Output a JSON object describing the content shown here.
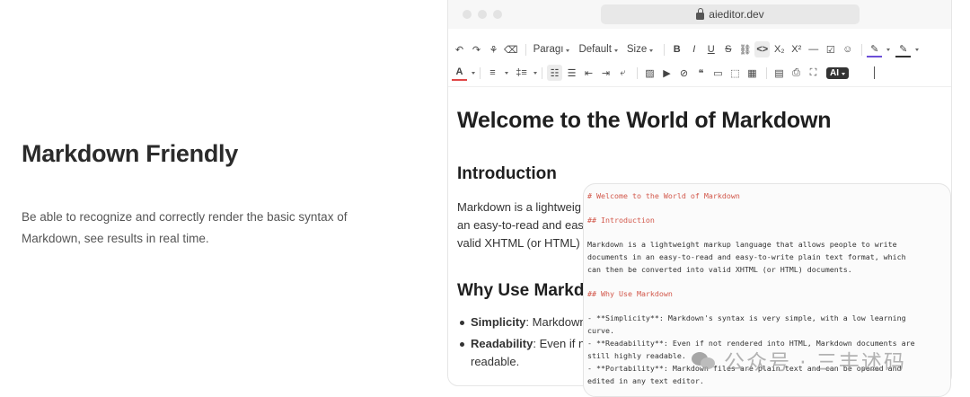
{
  "feature": {
    "title": "Markdown Friendly",
    "description": "Be able to recognize and correctly render the basic syntax of Markdown, see results in real time."
  },
  "browser": {
    "url": "aieditor.dev"
  },
  "toolbar": {
    "undo": "↶",
    "redo": "↷",
    "format_painter": "⚘",
    "eraser": "⌫",
    "paragraph": "Paragı",
    "font_family": "Default",
    "font_size": "Size",
    "bold": "B",
    "italic": "I",
    "underline": "U",
    "strike": "S",
    "link": "⛓",
    "code": "<>",
    "subscript": "X₂",
    "superscript": "X²",
    "hr": "—",
    "task": "☑",
    "emoji": "☺",
    "highlight": "✎",
    "font_color": "A",
    "align": "≡",
    "line_height": "‡≡",
    "bullet_list": "☷",
    "ordered_list": "☰",
    "indent_decrease": "⇤",
    "indent_increase": "⇥",
    "break": "⤶",
    "image": "▨",
    "video": "▶",
    "attachment": "⊘",
    "quote": "❝",
    "code_block": "▭",
    "container": "⬚",
    "table": "▦",
    "template": "▤",
    "print": "⎙",
    "fullscreen": "⛶",
    "ai": "AI"
  },
  "document": {
    "h1": "Welcome to the World of Markdown",
    "intro_heading": "Introduction",
    "intro_lines": [
      "Markdown is a lightweig",
      "an easy-to-read and easy",
      "valid XHTML (or HTML) c"
    ],
    "why_heading": "Why Use Markd",
    "list": [
      {
        "label": "Simplicity",
        "rest": ": Markdown"
      },
      {
        "label": "Readability",
        "rest": ": Even if nc",
        "cont": "readable."
      }
    ]
  },
  "markdown_source": [
    {
      "text": "# Welcome to the World of Markdown",
      "heading": true
    },
    {
      "text": "",
      "gap": true
    },
    {
      "text": "## Introduction",
      "heading": true
    },
    {
      "text": "",
      "gap": true
    },
    {
      "text": "Markdown is a lightweight markup language that allows people to write"
    },
    {
      "text": "documents in an easy-to-read and easy-to-write plain text format, which"
    },
    {
      "text": "can then be converted into valid XHTML (or HTML) documents."
    },
    {
      "text": "",
      "gap": true
    },
    {
      "text": "## Why Use Markdown",
      "heading": true
    },
    {
      "text": "",
      "gap": true
    },
    {
      "text": "- **Simplicity**: Markdown's syntax is very simple, with a low learning"
    },
    {
      "text": "curve."
    },
    {
      "text": "- **Readability**: Even if not rendered into HTML, Markdown documents are"
    },
    {
      "text": "still highly readable."
    },
    {
      "text": "- **Portability**: Markdown files are plain text and can be opened and"
    },
    {
      "text": "edited in any text editor."
    }
  ],
  "watermark": {
    "text": "公众号 · 三丰述码"
  },
  "colors": {
    "md_heading": "#d2574a",
    "panel_bg": "#fbfbfb",
    "titlebar_bg": "#f7f7f7"
  }
}
